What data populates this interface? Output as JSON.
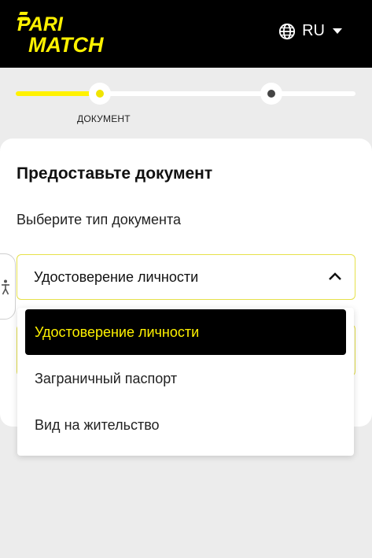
{
  "header": {
    "logo_line1": "PARI",
    "logo_line2": "MATCH",
    "logo_color": "#fff200",
    "language_label": "RU",
    "globe_icon": "globe-icon",
    "caret_icon": "caret-down-icon"
  },
  "stepper": {
    "active_step_label": "ДОКУМЕНТ",
    "accent_color": "#fff200"
  },
  "form": {
    "title": "Предоставьте документ",
    "select_label": "Выберите тип документа",
    "selected_value": "Удостоверение личности",
    "select_icon": "chevron-up-icon"
  },
  "dropdown": {
    "options": [
      "Удостоверение личности",
      "Заграничный паспорт",
      "Вид на жительство"
    ],
    "selected_index": 0
  },
  "accessibility": {
    "icon": "accessibility-icon"
  }
}
